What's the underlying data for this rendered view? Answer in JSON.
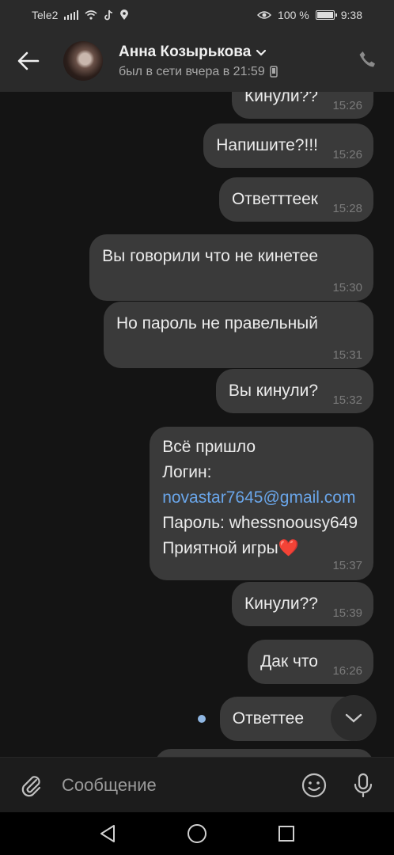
{
  "status_bar": {
    "carrier": "Tele2",
    "battery": "100 %",
    "time": "9:38",
    "icons": [
      "signal-icon",
      "wifi-icon",
      "tiktok-icon",
      "location-icon",
      "eye-icon",
      "battery-icon"
    ]
  },
  "header": {
    "name": "Анна Козырькова",
    "status": "был в сети вчера в 21:59",
    "icons": [
      "back-arrow-icon",
      "chevron-down-icon",
      "mobile-icon",
      "phone-icon"
    ]
  },
  "messages": [
    {
      "lines": [
        "Кинули??"
      ],
      "time": "15:26"
    },
    {
      "lines": [
        "Напишите?!!!"
      ],
      "time": "15:26"
    },
    {
      "lines": [
        "Ответттеек"
      ],
      "time": "15:28"
    },
    {
      "lines": [
        "Вы говорили что не кинетее"
      ],
      "time": "15:30"
    },
    {
      "lines": [
        "Но пароль не правельный"
      ],
      "time": "15:31"
    },
    {
      "lines": [
        "Вы кинули?"
      ],
      "time": "15:32"
    },
    {
      "lines": [
        "Всё пришло",
        "Логин:",
        "novastar7645@gmail.com",
        "Пароль: whessnoousy649",
        "Приятной игры❤️"
      ],
      "time": "15:37"
    },
    {
      "lines": [
        "Кинули??"
      ],
      "time": "15:39"
    },
    {
      "lines": [
        "Дак что"
      ],
      "time": "16:26"
    },
    {
      "lines": [
        "Ответтее"
      ],
      "time": ""
    }
  ],
  "composer": {
    "placeholder": "Сообщение",
    "icons": [
      "paperclip-icon",
      "emoji-icon",
      "microphone-icon"
    ]
  },
  "navbar": {
    "icons": [
      "nav-back-icon",
      "nav-home-icon",
      "nav-recents-icon"
    ]
  }
}
